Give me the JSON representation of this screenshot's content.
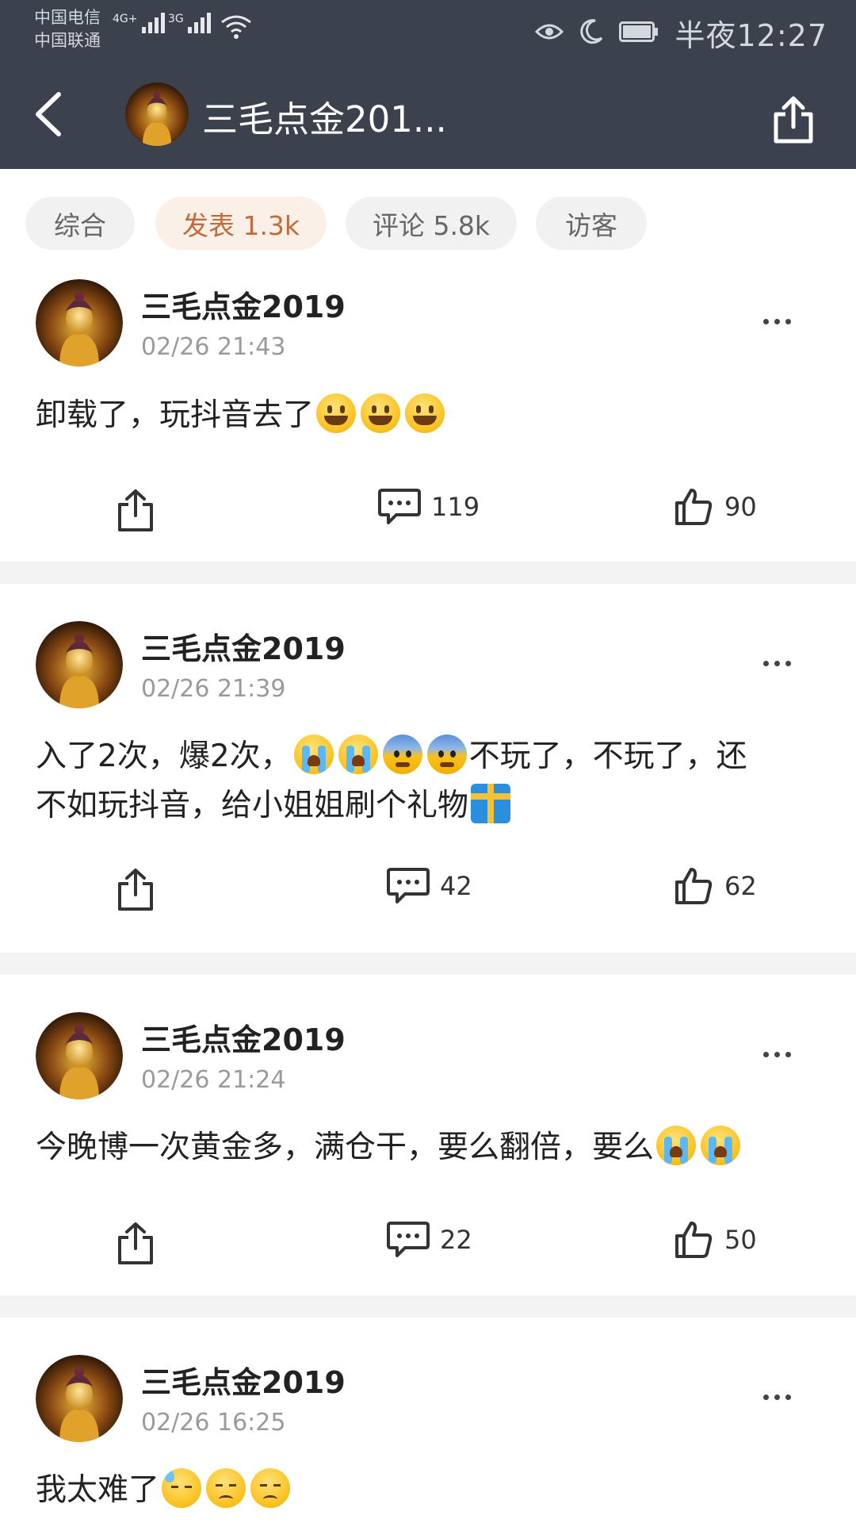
{
  "status_bar": {
    "carrier1": "中国电信",
    "carrier2": "中国联通",
    "net1": "4G+",
    "net2": "3G",
    "time": "半夜12:27"
  },
  "nav": {
    "title": "三毛点金201..."
  },
  "tabs": [
    {
      "label": "综合",
      "active": false
    },
    {
      "label": "发表 1.3k",
      "active": true
    },
    {
      "label": "评论 5.8k",
      "active": false
    },
    {
      "label": "访客",
      "active": false
    }
  ],
  "posts": [
    {
      "username": "三毛点金2019",
      "time": "02/26 21:43",
      "text1": "卸载了，玩抖音去了",
      "comments": "119",
      "likes": "90"
    },
    {
      "username": "三毛点金2019",
      "time": "02/26 21:39",
      "text1": "入了2次，爆2次，",
      "text2": "不玩了，不玩了，还",
      "text3": "不如玩抖音，给小姐姐刷个礼物",
      "comments": "42",
      "likes": "62"
    },
    {
      "username": "三毛点金2019",
      "time": "02/26 21:24",
      "text1": "今晚博一次黄金多，满仓干，要么翻倍，要么",
      "comments": "22",
      "likes": "50"
    },
    {
      "username": "三毛点金2019",
      "time": "02/26 16:25",
      "text1": "我太难了"
    }
  ],
  "colors": {
    "header_bg": "#3b414d",
    "active_tab_text": "#c26a3a",
    "active_tab_bg": "#fbf0e8"
  }
}
